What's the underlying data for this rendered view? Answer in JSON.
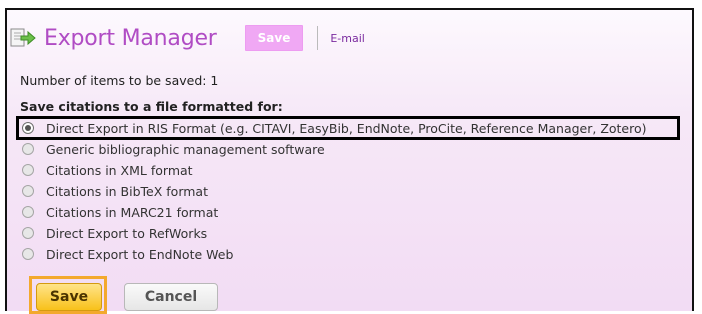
{
  "header": {
    "title": "Export Manager",
    "save_label": "Save",
    "email_label": "E-mail",
    "icon": "export-arrow-icon"
  },
  "count_text": "Number of items to be saved: 1",
  "section_label": "Save citations to a file formatted for:",
  "options": [
    {
      "label": "Direct Export in RIS Format (e.g. CITAVI, EasyBib, EndNote, ProCite, Reference Manager, Zotero)",
      "checked": true
    },
    {
      "label": "Generic bibliographic management software",
      "checked": false
    },
    {
      "label": "Citations in XML format",
      "checked": false
    },
    {
      "label": "Citations in BibTeX format",
      "checked": false
    },
    {
      "label": "Citations in MARC21 format",
      "checked": false
    },
    {
      "label": "Direct Export to RefWorks",
      "checked": false
    },
    {
      "label": "Direct Export to EndNote Web",
      "checked": false
    }
  ],
  "buttons": {
    "save_label": "Save",
    "cancel_label": "Cancel"
  },
  "colors": {
    "title": "#b04cc4",
    "save_top_bg": "#f0a8f4",
    "save_button": "#f8c11a",
    "highlight_outline": "#f3a92d"
  }
}
